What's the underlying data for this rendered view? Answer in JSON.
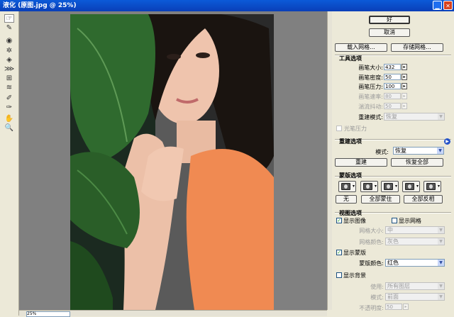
{
  "window": {
    "title": "液化 (原图.jpg @ 25%)"
  },
  "canvas": {
    "zoom": "25%"
  },
  "buttons": {
    "ok": "好",
    "cancel": "取消",
    "load_mesh": "载入网格...",
    "save_mesh": "存储网格...",
    "reconstruct": "重建",
    "restore_all": "恢复全部",
    "mask_none": "无",
    "mask_all": "全部蒙住",
    "mask_invert": "全部反相"
  },
  "tool_options": {
    "title": "工具选项",
    "brush_size_label": "画笔大小:",
    "brush_size": "432",
    "brush_density_label": "画笔密度:",
    "brush_density": "50",
    "brush_pressure_label": "画笔压力:",
    "brush_pressure": "100",
    "brush_rate_label": "画笔速率:",
    "brush_rate": "80",
    "turbulent_jitter_label": "湍流抖动:",
    "turbulent_jitter": "50",
    "reconstruct_mode_label": "重建模式:",
    "reconstruct_mode": "恢复",
    "stylus_pressure": "光笔压力"
  },
  "reconstruct_options": {
    "title": "重建选项",
    "mode_label": "模式:",
    "mode": "恢复"
  },
  "mask_options": {
    "title": "蒙版选项"
  },
  "view_options": {
    "title": "视图选项",
    "show_image": "显示图像",
    "show_mesh": "显示网格",
    "mesh_size_label": "网格大小:",
    "mesh_size": "中",
    "mesh_color_label": "网格颜色:",
    "mesh_color": "灰色",
    "show_mask": "显示蒙版",
    "mask_color_label": "蒙版颜色:",
    "mask_color": "红色",
    "show_backdrop": "显示背景",
    "use_label": "使用:",
    "use": "所有图层",
    "backdrop_mode_label": "模式:",
    "backdrop_mode": "前面",
    "opacity_label": "不透明度:",
    "opacity": "50"
  },
  "icons": {
    "tools": [
      "warp-icon",
      "reconstruct-icon",
      "twirl-cw-icon",
      "pucker-icon",
      "bloat-icon",
      "push-left-icon",
      "mirror-icon",
      "turbulence-icon",
      "freeze-mask-icon",
      "thaw-mask-icon",
      "hand-icon",
      "zoom-icon"
    ],
    "info": "info-icon"
  },
  "colors": {
    "titlebar": "#0a3fb8",
    "panel": "#ece9d8",
    "canvas_bg": "#808080",
    "shirt": "#f08a52",
    "leaf": "#2f6a2e"
  }
}
